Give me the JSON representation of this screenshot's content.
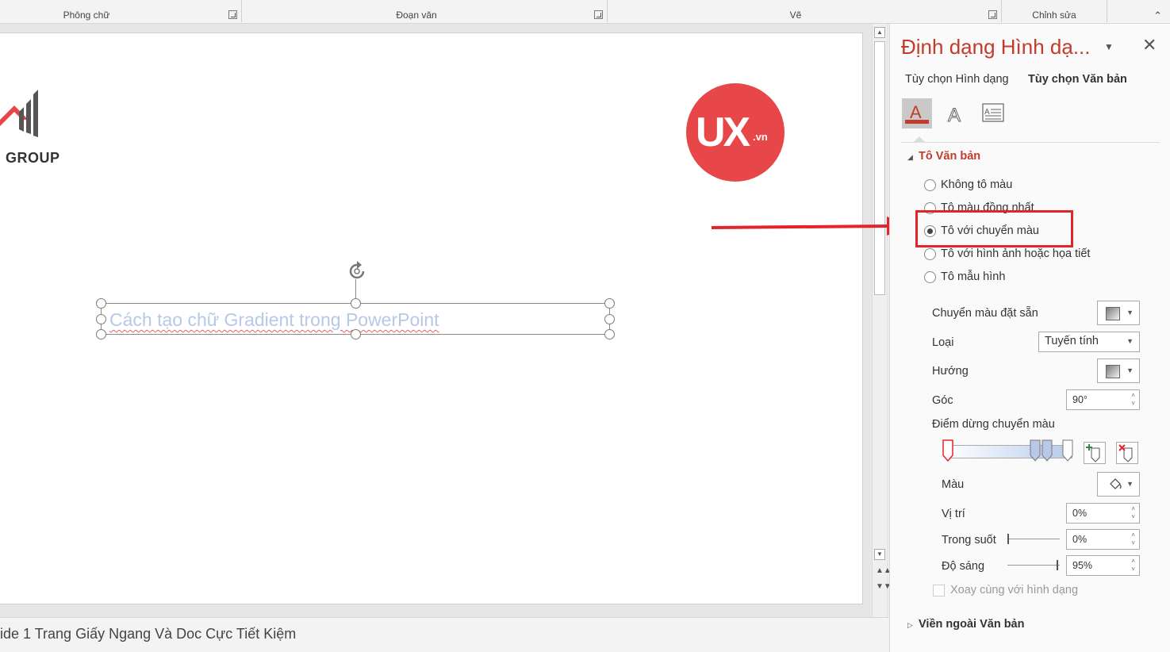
{
  "ribbon": {
    "groups": [
      "Phông chữ",
      "Đoạn văn",
      "Vẽ",
      "Chỉnh sửa"
    ]
  },
  "slide": {
    "logo_left_text": "GROUP",
    "logo_right_main": "UX",
    "logo_right_suffix": ".vn",
    "textbox_text": "Cách tạo chữ Gradient trong PowerPoint"
  },
  "notes_bar": {
    "text": "ide 1 Trang Giấy Ngang Và Doc Cực Tiết Kiệm"
  },
  "pane": {
    "title": "Định dạng Hình dạ...",
    "tabs": [
      "Tùy chọn Hình dạng",
      "Tùy chọn Văn bản"
    ],
    "active_tab": "Tùy chọn Văn bản",
    "icons": [
      "text-fill-outline-icon",
      "text-effects-icon",
      "textbox-layout-icon"
    ],
    "section_fill": "Tô Văn bản",
    "fill_options": [
      {
        "label": "Không tô màu",
        "selected": false
      },
      {
        "label": "Tô màu đồng nhất",
        "selected": false
      },
      {
        "label": "Tô với chuyển màu",
        "selected": true
      },
      {
        "label": "Tô với hình ảnh hoặc họa tiết",
        "selected": false
      },
      {
        "label": "Tô mẫu hình",
        "selected": false
      }
    ],
    "preset_label": "Chuyển màu đặt sẵn",
    "type_label": "Loại",
    "type_value": "Tuyến tính",
    "direction_label": "Hướng",
    "angle_label": "Góc",
    "angle_value": "90°",
    "stops_label": "Điểm dừng chuyển màu",
    "color_label": "Màu",
    "position_label": "Vị trí",
    "position_value": "0%",
    "transparency_label": "Trong suốt",
    "transparency_value": "0%",
    "brightness_label": "Độ sáng",
    "brightness_value": "95%",
    "rotate_with_shape_label": "Xoay cùng với hình dạng",
    "section_outline": "Viền ngoài Văn bản"
  },
  "colors": {
    "accent": "#c23b2b",
    "annotation": "#e3242b",
    "ux_logo": "#e8474a",
    "gradient_text": "#b7c8e8"
  }
}
